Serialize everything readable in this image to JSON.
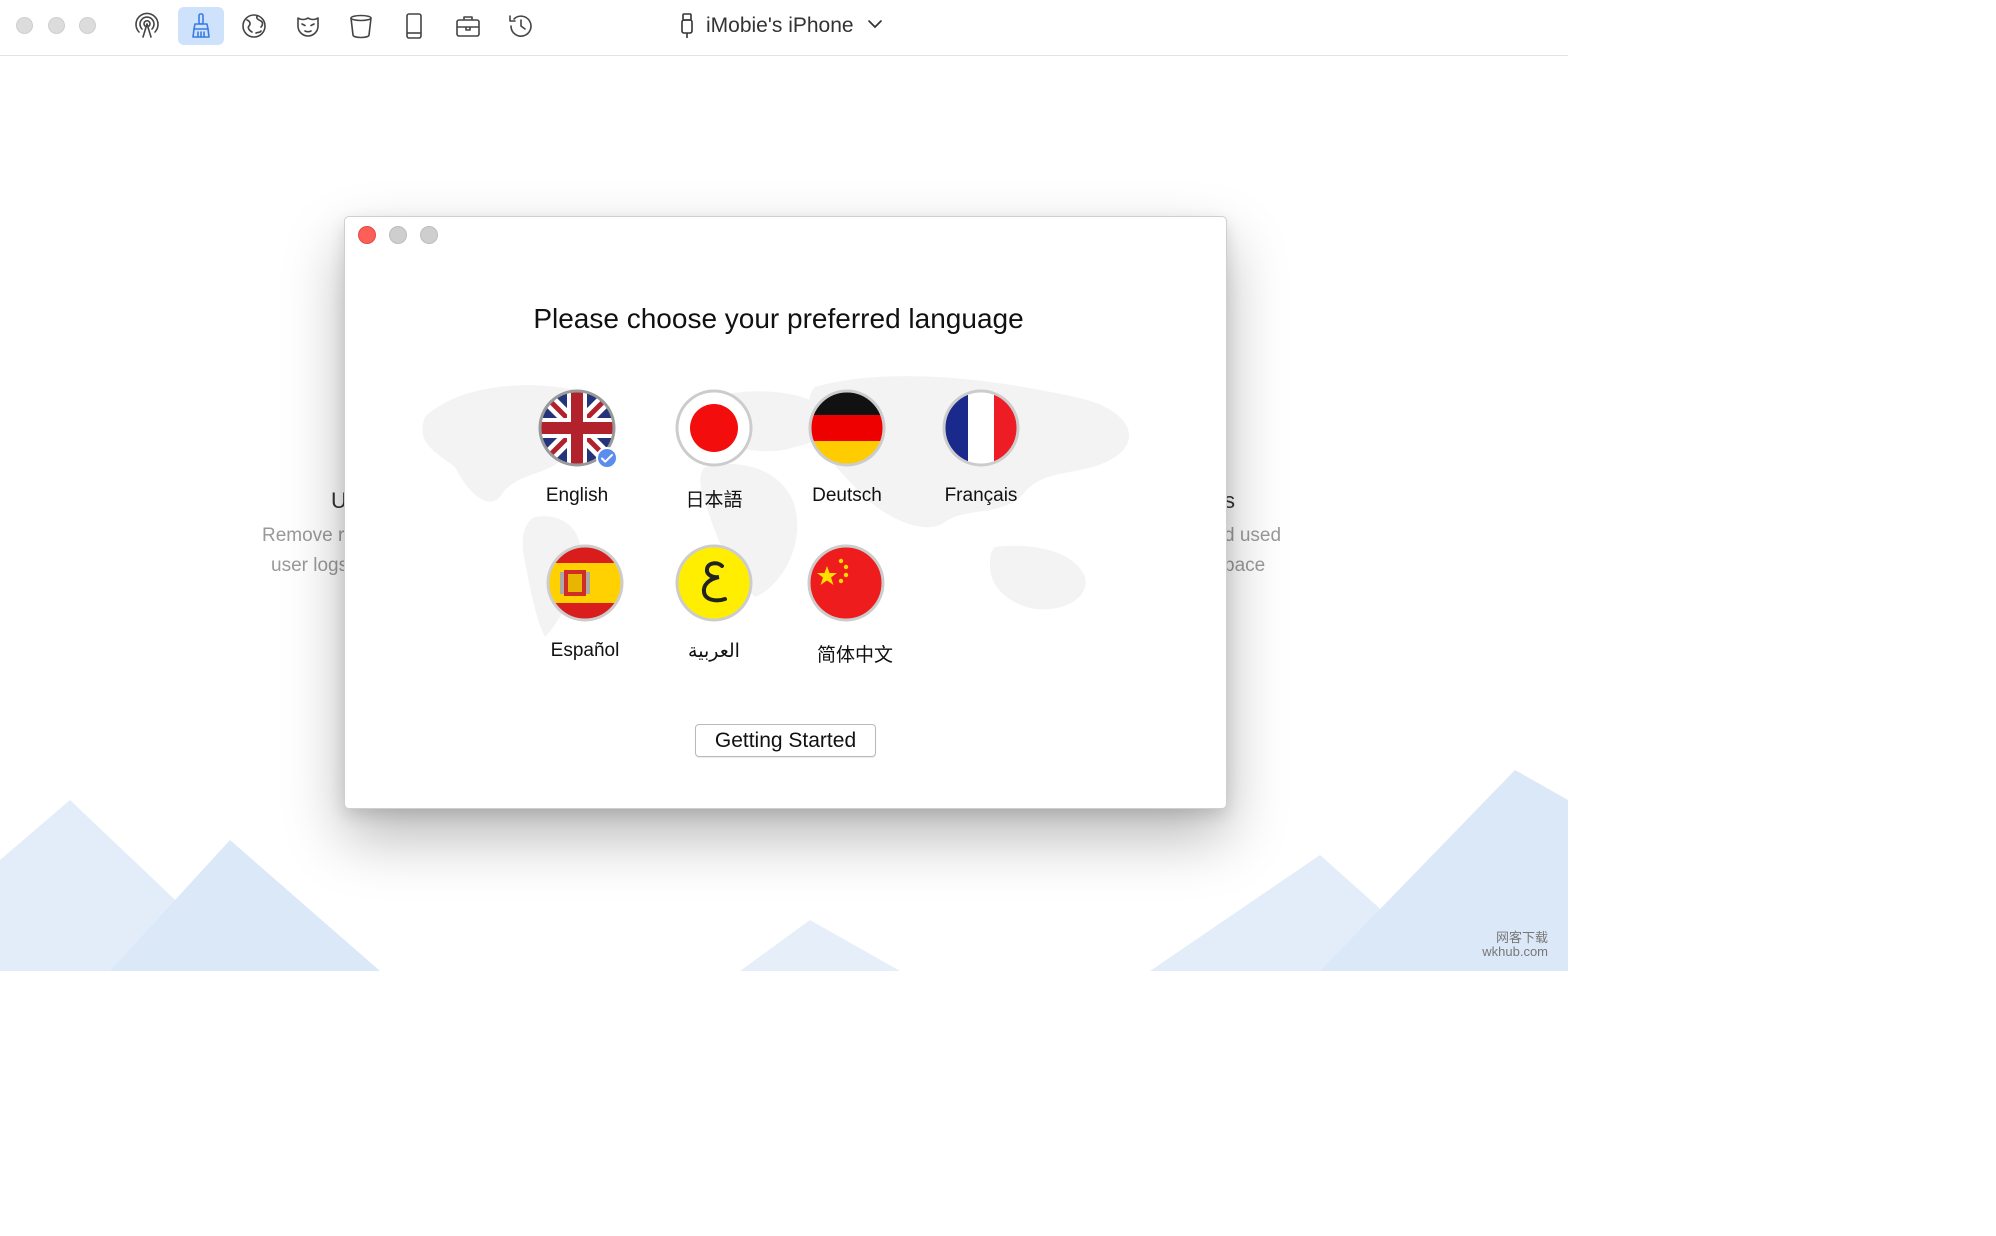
{
  "toolbar": {
    "icons": [
      "airdrop-icon",
      "cleaner-brush-icon",
      "globe-icon",
      "mask-icon",
      "trash-bin-icon",
      "tablet-icon",
      "toolbox-icon",
      "history-clock-icon"
    ],
    "active_index": 1,
    "device_name": "iMobie's iPhone",
    "accent": "#cfe2fb"
  },
  "background": {
    "left_heading": "U",
    "left_line1": "Remove r",
    "left_line2": "user logs",
    "right_heading": "s",
    "right_line1": "d used",
    "right_line2": "pace",
    "mountain_color": "#dbe8f8"
  },
  "dialog": {
    "title": "Please choose your preferred language",
    "languages": [
      {
        "label": "English",
        "flag": "uk-flag",
        "selected": true
      },
      {
        "label": "日本語",
        "flag": "japan-flag",
        "selected": false
      },
      {
        "label": "Deutsch",
        "flag": "germany-flag",
        "selected": false
      },
      {
        "label": "Français",
        "flag": "france-flag",
        "selected": false
      },
      {
        "label": "Español",
        "flag": "spain-flag",
        "selected": false
      },
      {
        "label": "العربية",
        "flag": "arabic-flag",
        "selected": false
      },
      {
        "label": "简体中文",
        "flag": "china-flag",
        "selected": false
      }
    ],
    "button_label": "Getting Started"
  },
  "watermark": {
    "line1": "网客下载",
    "line2": "wkhub.com"
  }
}
